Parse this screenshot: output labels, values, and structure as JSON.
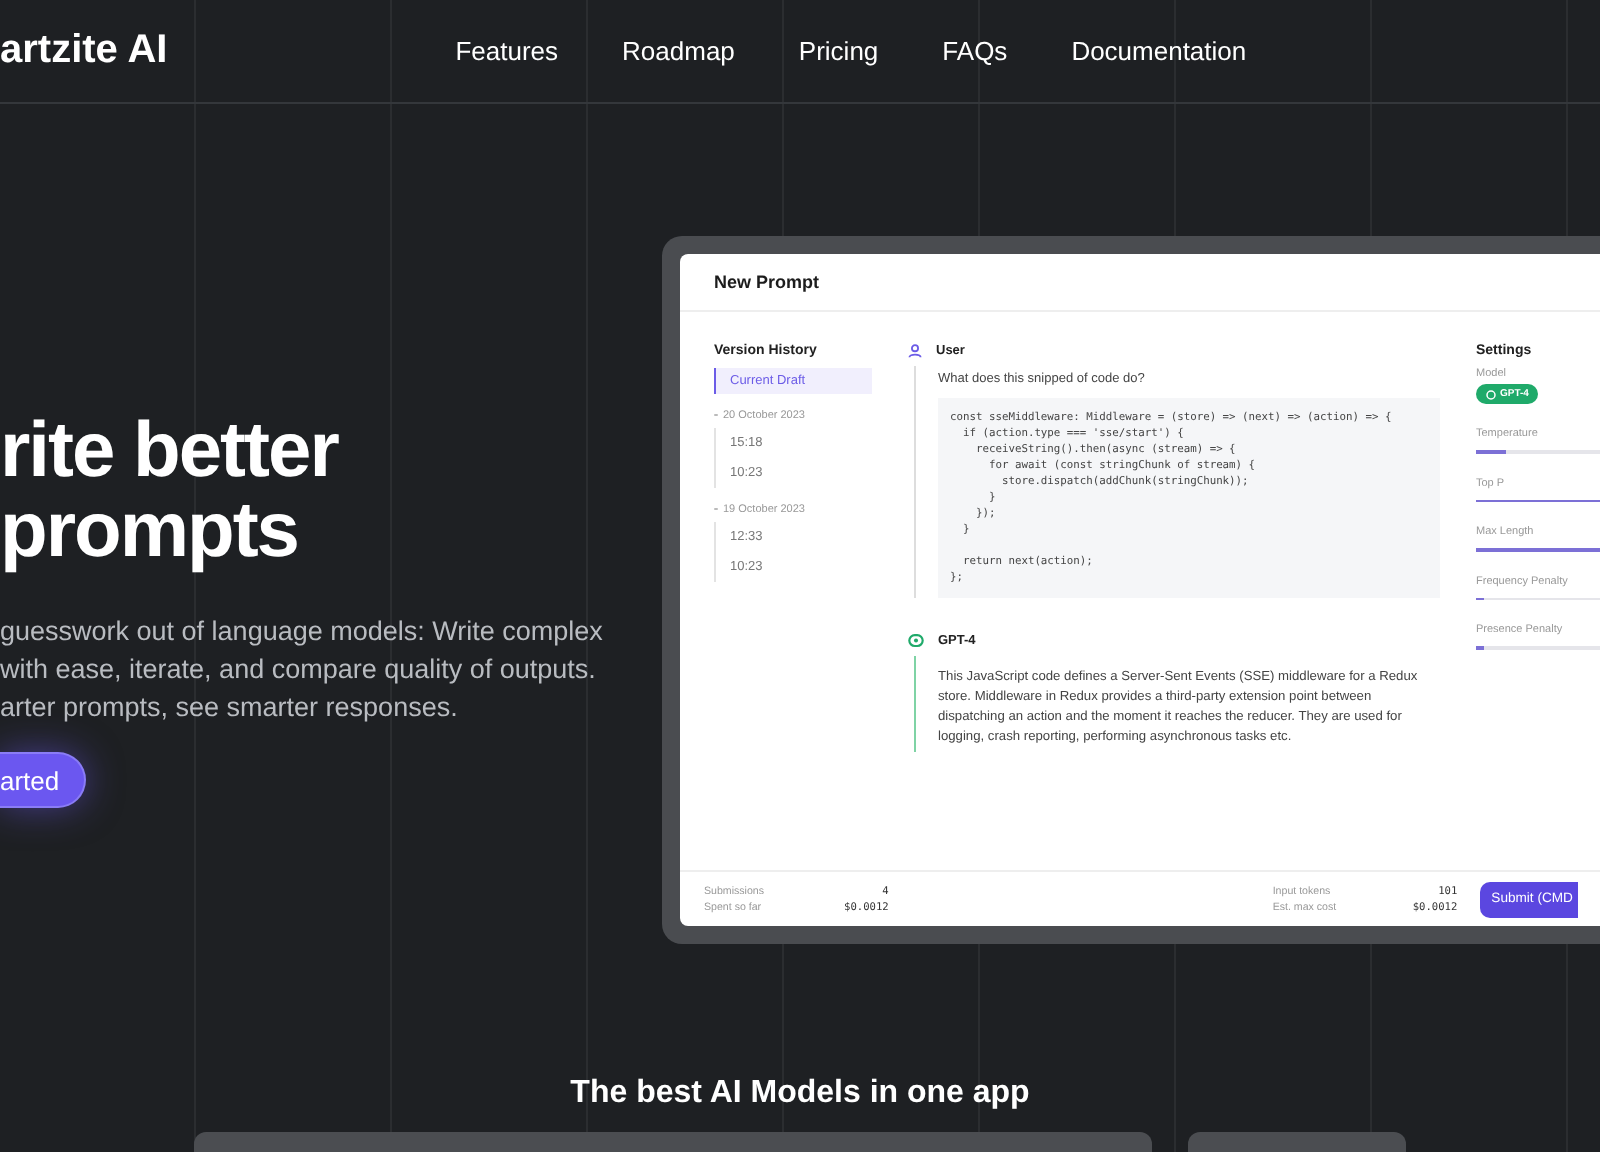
{
  "nav": {
    "logo": "artzite AI",
    "links": [
      "Features",
      "Roadmap",
      "Pricing",
      "FAQs",
      "Documentation"
    ]
  },
  "hero": {
    "title_lines": [
      "rite better",
      "prompts"
    ],
    "text_lines": [
      "guesswork out of language models: Write complex",
      "with ease, iterate, and compare quality of outputs.",
      "arter prompts, see smarter responses."
    ],
    "button": "arted"
  },
  "app": {
    "title": "New Prompt",
    "history": {
      "title": "Version History",
      "current": {
        "label": "Current Draft",
        "selected": true
      },
      "groups": [
        {
          "label": "20 October 2023",
          "children": [
            {
              "label": "15:18",
              "selected": false
            },
            {
              "label": "10:23",
              "selected": false
            }
          ]
        },
        {
          "label": "19 October 2023",
          "children": [
            {
              "label": "12:33",
              "selected": false
            },
            {
              "label": "10:23",
              "selected": false
            }
          ]
        }
      ]
    },
    "messages": [
      {
        "kind": "user",
        "author": "User",
        "text": "What does this snipped of code do?",
        "code": [
          [
            "const sseMiddleware: Middleware = (store) => (next) => (action) => {",
            "  if (action.type === 'sse/start') {",
            "    receiveString().then(async (stream) => {",
            "      for await (const stringChunk of stream) {",
            "        store.dispatch(addChunk(stringChunk));",
            "      }",
            "    });",
            "  }"
          ],
          [
            "  return next(action);",
            "};"
          ]
        ]
      },
      {
        "kind": "assistant",
        "author": "GPT-4",
        "text": "This JavaScript code defines a Server-Sent Events (SSE) middleware for a Redux store. Middleware in Redux provides a third-party extension point between dispatching an action and the moment it reaches the reducer. They are used for logging, crash reporting, performing asynchronous tasks etc."
      }
    ],
    "settings": {
      "title": "Settings",
      "model_label": "Model",
      "model": "GPT-4",
      "sliders": [
        {
          "label": "Temperature",
          "level": 0.12
        },
        {
          "label": "Top P",
          "level": 1
        },
        {
          "label": "Max Length",
          "level": 0.7
        },
        {
          "label": "Frequency Penalty",
          "level": 0.03
        },
        {
          "label": "Presence Penalty",
          "level": 0.03
        }
      ]
    },
    "footer": {
      "left": [
        {
          "label": "Submissions",
          "value": "4"
        },
        {
          "label": "Spent so far",
          "value": "$0.0012"
        }
      ],
      "right": [
        {
          "label": "Input tokens",
          "value": "101"
        },
        {
          "label": "Est. max cost",
          "value": "$0.0012"
        }
      ],
      "button": "Submit (CMD"
    }
  },
  "models": {
    "heading": "The best AI Models in one app"
  }
}
